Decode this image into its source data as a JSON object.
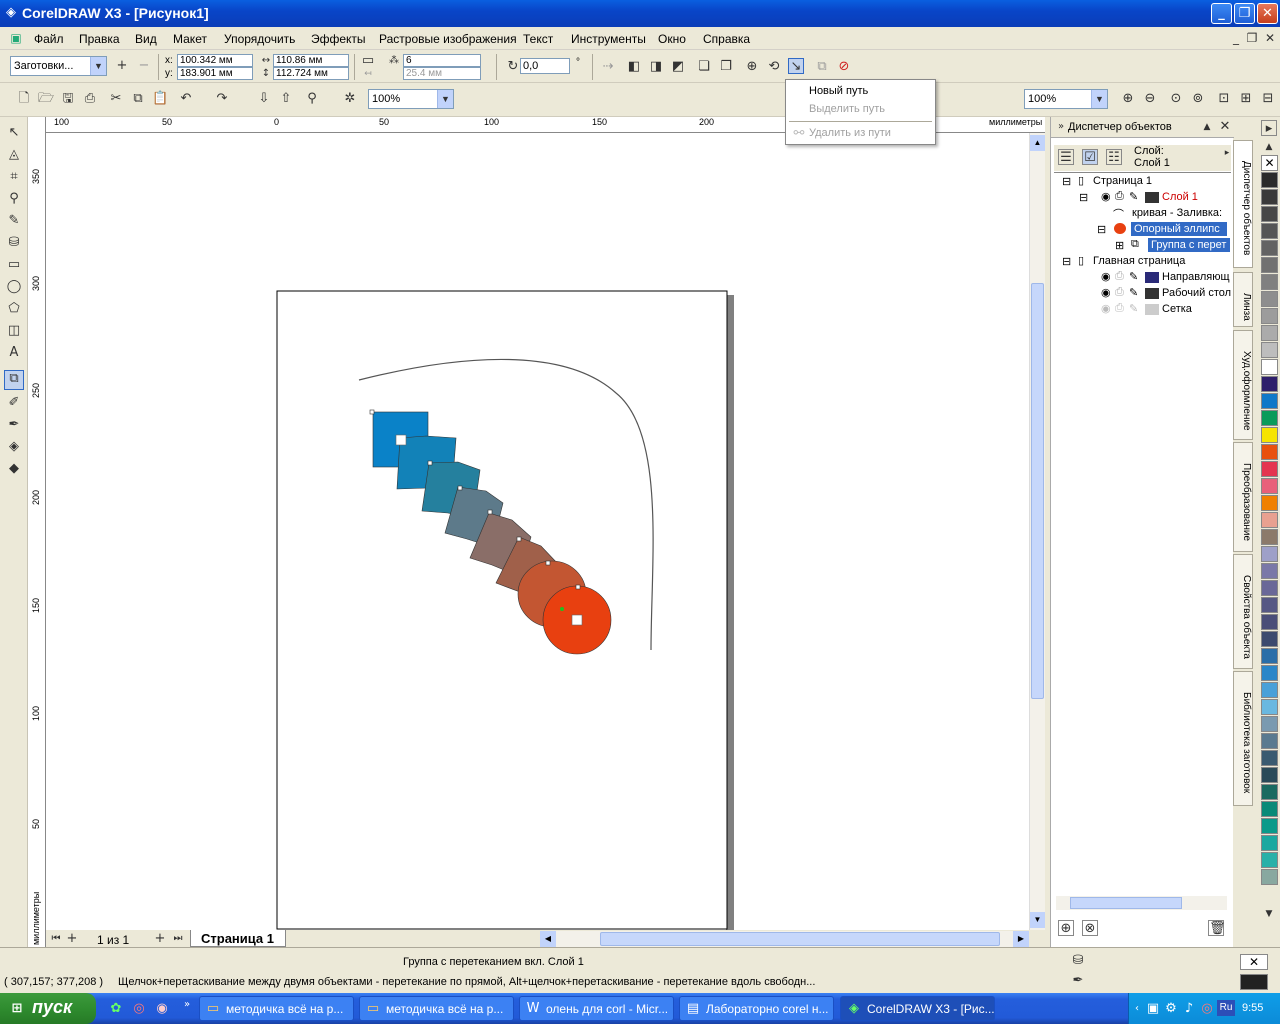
{
  "window": {
    "title": "CorelDRAW X3 - [Рисунок1]"
  },
  "menu": [
    "Файл",
    "Правка",
    "Вид",
    "Макет",
    "Упорядочить",
    "Эффекты",
    "Растровые изображения",
    "Текст",
    "Инструменты",
    "Окно",
    "Справка"
  ],
  "propbar": {
    "preset": "Заготовки...",
    "x_label": "x:",
    "y_label": "y:",
    "x": "100.342 мм",
    "y": "183.901 мм",
    "w": "110.86 мм",
    "h": "112.724 мм",
    "steps": "6",
    "spacing": "25.4 мм",
    "angle": "0,0",
    "deg": "°"
  },
  "stdbar": {
    "zoom": "100%",
    "zoom2": "100%"
  },
  "popup": {
    "items": [
      {
        "label": "Новый путь",
        "enabled": true
      },
      {
        "label": "Выделить путь",
        "enabled": false
      },
      {
        "label": "Удалить из пути",
        "enabled": false
      }
    ]
  },
  "rulers": {
    "h_ticks": [
      "100",
      "50",
      "0",
      "50",
      "100",
      "150",
      "200"
    ],
    "unit": "миллиметры",
    "v_ticks": [
      "350",
      "300",
      "250",
      "200",
      "150",
      "100",
      "50"
    ],
    "v_unit": "миллиметры"
  },
  "pages": {
    "counter": "1 из 1",
    "tab": "Страница 1"
  },
  "docker": {
    "title": "Диспетчер объектов",
    "layer_label": "Слой:",
    "layer_name": "Слой 1",
    "tree": {
      "page": "Страница 1",
      "layer": "Слой 1",
      "curve": "кривая - Заливка: ",
      "ellipse": "Опорный эллипс",
      "group": "Группа с перет",
      "master": "Главная страница",
      "guides": "Направляющ",
      "desktop": "Рабочий стол",
      "grid": "Сетка"
    }
  },
  "docker_tabs": [
    "Диспетчер объектов",
    "Линза",
    "Худ.оформление",
    "Преобразование",
    "Свойства объекта",
    "Библиотека заготовок"
  ],
  "palette": [
    "#2b2b2b",
    "#3a3a3a",
    "#474747",
    "#555",
    "#636363",
    "#717171",
    "#808080",
    "#8e8e8e",
    "#9c9c9c",
    "#ababab",
    "#bdbdbd",
    "#ffffff",
    "#2e1f6b",
    "#0f78c8",
    "#0a9b5a",
    "#f6e400",
    "#e8500e",
    "#e4344f",
    "#e8607a",
    "#f08000",
    "#e8a090",
    "#8c7a6a",
    "#9ea0c8",
    "#7a78a8",
    "#6a6898",
    "#565884",
    "#4a4e78",
    "#3c4a6e",
    "#2a6ea8",
    "#2a86c8",
    "#4aa0d8",
    "#6ab8e0",
    "#7a9ab0",
    "#5a7a90",
    "#3a5a70",
    "#2a4a58",
    "#1a6a60",
    "#0a8a78",
    "#0a9a8a",
    "#1aa8a0",
    "#2ab0a8",
    "#88a8a0"
  ],
  "status": {
    "object": "Группа с перетеканием вкл. Слой 1",
    "coords": "( 307,157; 377,208 )",
    "hint": "Щелчок+перетаскивание между двумя объектами - перетекание по прямой, Alt+щелчок+перетаскивание - перетекание вдоль свободн..."
  },
  "taskbar": {
    "start": "пуск",
    "tasks": [
      "методичка всё на р...",
      "методичка всё на р...",
      "олень для corl - Micr...",
      "Лабораторно corel н...",
      "CorelDRAW X3 - [Рис..."
    ],
    "lang": "Ru",
    "time": "9:55"
  },
  "colors": {
    "accent": "#0a5fe0",
    "ellipse": "#e84010",
    "rect": "#0a82c8"
  }
}
